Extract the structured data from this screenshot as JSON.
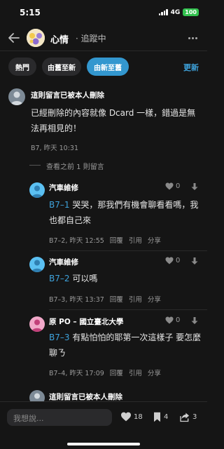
{
  "status": {
    "time": "5:15",
    "network": "4G",
    "battery": "100"
  },
  "header": {
    "board_name": "心情",
    "separator_follow": "· 追蹤中"
  },
  "sort": {
    "options": [
      "熱門",
      "由舊至新",
      "由新至舊"
    ],
    "active": "由新至舊",
    "refresh": "更新"
  },
  "comments": [
    {
      "author": "這則留言已被本人刪除",
      "body": "已經刪除的內容就像 Dcard 一樣，錯過是無法再相見的！",
      "meta": "B7, 昨天 10:31"
    }
  ],
  "expand": {
    "label": "查看之前 1 則留言"
  },
  "replies": [
    {
      "author": "汽車維修",
      "floor": "B7–1",
      "body": " 哭哭，那我們有機會聊看看嗎，我也都自己來",
      "meta": "B7–2, 昨天 12:55",
      "likes": "0",
      "actions": [
        "回覆",
        "引用",
        "分享"
      ]
    },
    {
      "author": "汽車維修",
      "floor": "B7–2",
      "body": " 可以嗎",
      "meta": "B7–3, 昨天 13:37",
      "likes": "0",
      "actions": [
        "回覆",
        "引用",
        "分享"
      ]
    },
    {
      "author": "原 PO – 國立臺北大學",
      "floor": "B7–3",
      "body": " 有點怕怕的耶第一次這樣子 要怎麼聊ㄋ",
      "meta": "B7–4, 昨天 17:09",
      "likes": "0",
      "actions": [
        "回覆",
        "引用",
        "分享"
      ]
    }
  ],
  "next_comment": {
    "author": "這則留言已被本人刪除"
  },
  "bottom": {
    "input_placeholder": "我想說...",
    "likes": "18",
    "saves": "4",
    "shares": "3"
  },
  "colors": {
    "accent": "#3397cf",
    "link": "#3ea2db",
    "background": "#151515"
  }
}
